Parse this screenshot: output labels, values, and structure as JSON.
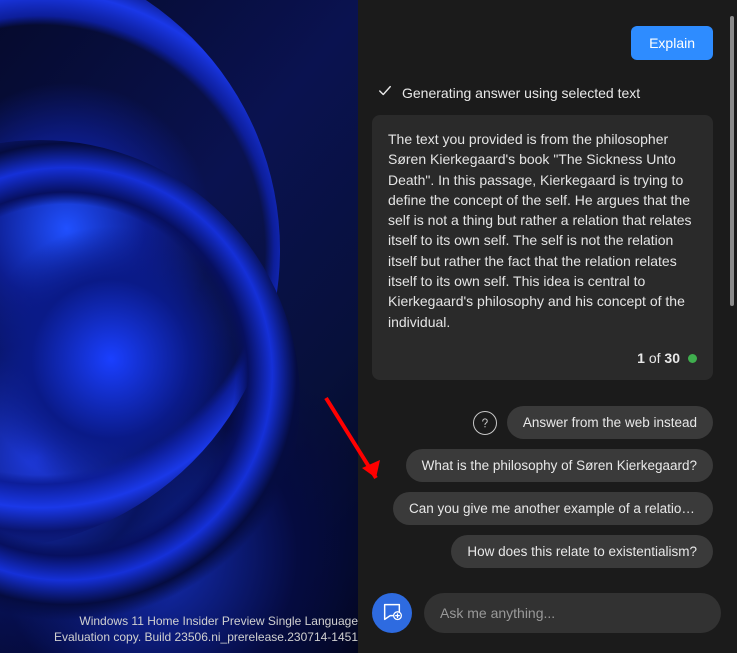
{
  "watermark": {
    "line1": "Windows 11 Home Insider Preview Single Language",
    "line2": "Evaluation copy. Build 23506.ni_prerelease.230714-1451"
  },
  "user_message": {
    "label": "Explain"
  },
  "status": {
    "text": "Generating answer using selected text"
  },
  "answer": {
    "body": "The text you provided is from the philosopher Søren Kierkegaard's book \"The Sickness Unto Death\". In this passage, Kierkegaard is trying to define the concept of the self. He argues that the self is not a thing but rather a relation that relates itself to its own self. The self is not the relation itself but rather the fact that the relation relates itself to its own self. This idea is central to Kierkegaard's philosophy and his concept of the individual.",
    "pager_prefix": "1",
    "pager_middle": " of ",
    "pager_total": "30"
  },
  "suggestions": {
    "web": "Answer from the web instead",
    "s1": "What is the philosophy of Søren Kierkegaard?",
    "s2": "Can you give me another example of a relation t...",
    "s3": "How does this relate to existentialism?"
  },
  "composer": {
    "placeholder": "Ask me anything..."
  },
  "colors": {
    "accent": "#2e8cff",
    "status_dot": "#3fae4e",
    "arrow": "#ff0000"
  }
}
